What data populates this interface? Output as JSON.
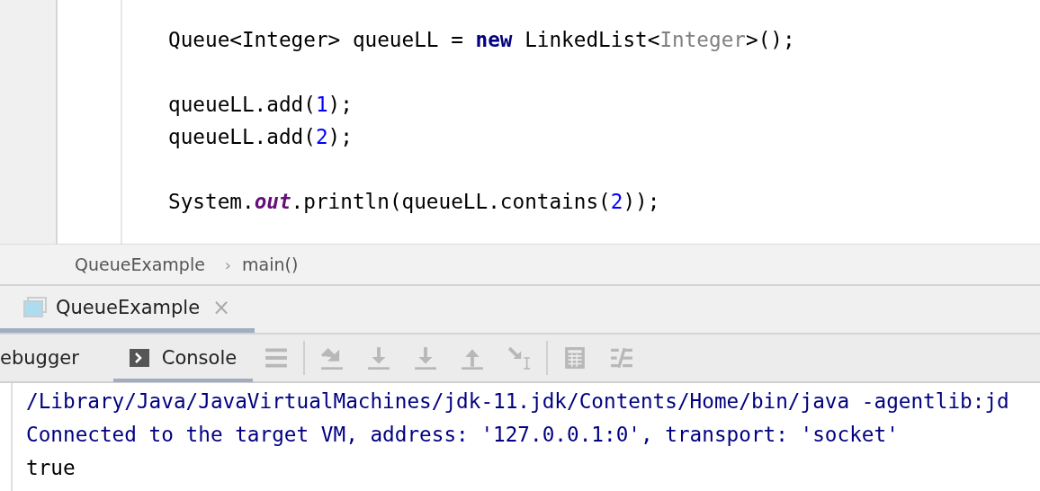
{
  "editor": {
    "lines": [
      {
        "kind": "code",
        "tokens": [
          {
            "text": "Queue<Integer> queueLL = ",
            "kind": "plain"
          },
          {
            "text": "new",
            "kind": "keyword"
          },
          {
            "text": " LinkedList<",
            "kind": "plain"
          },
          {
            "text": "Integer",
            "kind": "inferred"
          },
          {
            "text": ">();",
            "kind": "plain"
          }
        ]
      },
      {
        "kind": "blank"
      },
      {
        "kind": "code",
        "tokens": [
          {
            "text": "queueLL.add(",
            "kind": "plain"
          },
          {
            "text": "1",
            "kind": "number"
          },
          {
            "text": ");",
            "kind": "plain"
          }
        ]
      },
      {
        "kind": "code",
        "tokens": [
          {
            "text": "queueLL.add(",
            "kind": "plain"
          },
          {
            "text": "2",
            "kind": "number"
          },
          {
            "text": ");",
            "kind": "plain"
          }
        ]
      },
      {
        "kind": "blank"
      },
      {
        "kind": "code",
        "tokens": [
          {
            "text": "System.",
            "kind": "plain"
          },
          {
            "text": "out",
            "kind": "static"
          },
          {
            "text": ".println(queueLL.contains(",
            "kind": "plain"
          },
          {
            "text": "2",
            "kind": "number"
          },
          {
            "text": "));",
            "kind": "plain"
          }
        ]
      }
    ]
  },
  "breadcrumb": [
    "QueueExample",
    "main()"
  ],
  "breadcrumb_separator": "›",
  "run_tab": {
    "label": "QueueExample",
    "close": "×",
    "selected": true
  },
  "debug_tabs": [
    {
      "label": "ebugger",
      "selected": false
    },
    {
      "label": "Console",
      "selected": true
    }
  ],
  "console": [
    {
      "text": "/Library/Java/JavaVirtualMachines/jdk-11.jdk/Contents/Home/bin/java -agentlib:jd",
      "kind": "system"
    },
    {
      "text": "Connected to the target VM, address: '127.0.0.1:0', transport: 'socket'",
      "kind": "system"
    },
    {
      "text": "true",
      "kind": "output"
    }
  ]
}
